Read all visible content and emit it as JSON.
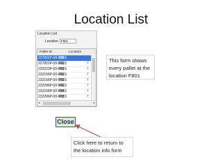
{
  "slide": {
    "title": "Location List"
  },
  "window": {
    "title": "Location List",
    "location_label": "Location",
    "location_value": "F801",
    "columns": [
      "Pallet ID",
      "Location"
    ],
    "rows": [
      {
        "pallet_id": "227831P-00-003",
        "location": "F801",
        "extra": "",
        "selected": true
      },
      {
        "pallet_id": "227831P-00-001",
        "location": "F801",
        "extra": "T"
      },
      {
        "pallet_id": "232023P-00-002",
        "location": "F801",
        "extra": "T"
      },
      {
        "pallet_id": "233156P-00-001",
        "location": "F801",
        "extra": "T"
      },
      {
        "pallet_id": "233156P-00-002",
        "location": "F801",
        "extra": "T"
      },
      {
        "pallet_id": "232296P-00-001",
        "location": "F801",
        "extra": "T"
      },
      {
        "pallet_id": "233156P-00-004",
        "location": "F801",
        "extra": "T"
      },
      {
        "pallet_id": "232296P-00-002",
        "location": "F801",
        "extra": "T"
      }
    ],
    "scroll_left": "◂",
    "scroll_right": "▸"
  },
  "callout_text": "This form shows every pallet at the location  F801",
  "close_button_label": "Close",
  "instruction_text": "Click here to return to the location info form",
  "colors": {
    "selection": "#3a78d6",
    "button_fill": "#dcecc6",
    "button_border": "#3f4e9a",
    "arrow": "#c0504d"
  }
}
